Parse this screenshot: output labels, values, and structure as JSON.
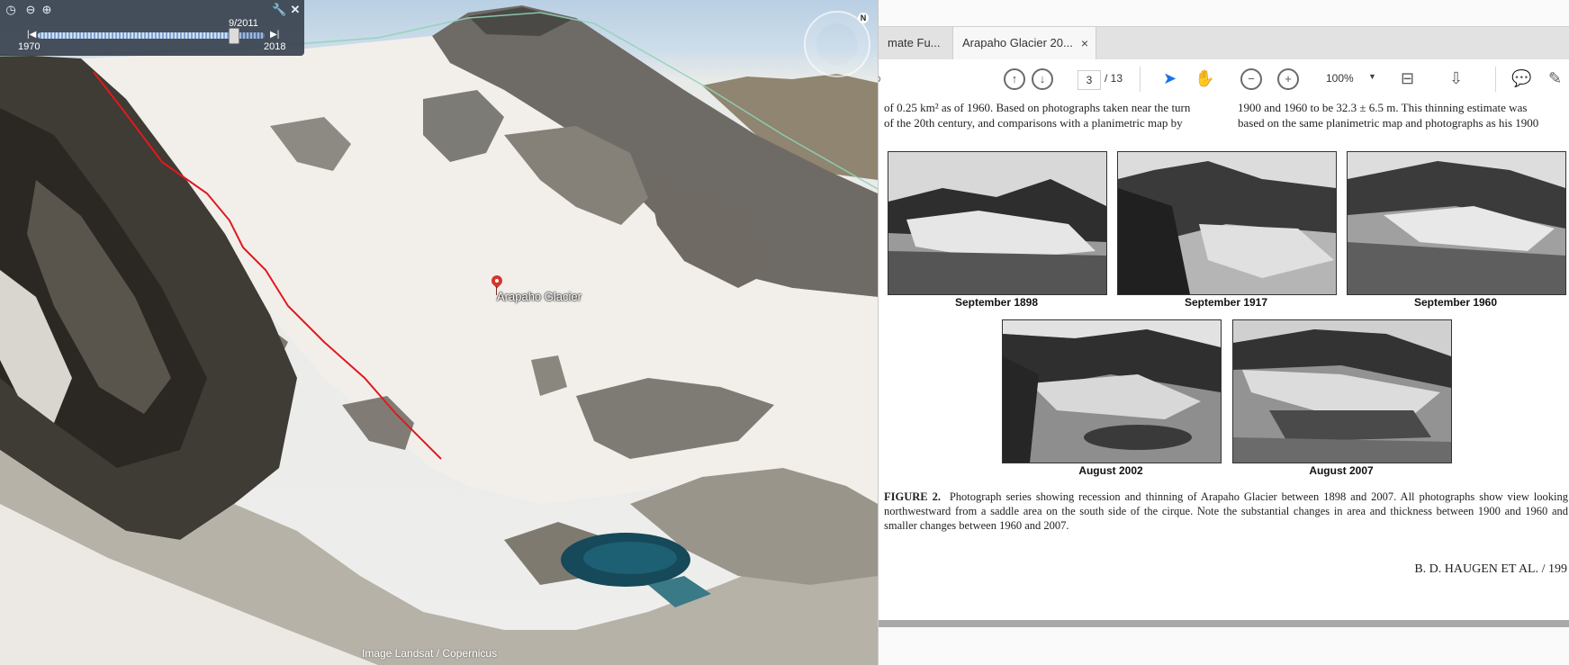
{
  "earth": {
    "placemark_label": "Arapaho Glacier",
    "attribution": "Image Landsat / Copernicus",
    "timeslider": {
      "current_date": "9/2011",
      "start_year": "1970",
      "end_year": "2018",
      "position_fraction": 0.86
    },
    "icons": [
      "clock-icon",
      "zoom-out-icon",
      "zoom-in-icon",
      "wrench-icon",
      "close-icon",
      "compass-icon"
    ]
  },
  "pdf": {
    "tabs": [
      {
        "label": "mate Fu..."
      },
      {
        "label": "Arapaho Glacier 20..."
      }
    ],
    "tab_close": "×",
    "toolbar": {
      "current_page": "3",
      "page_sep": "/ 13",
      "zoom": "100%"
    },
    "page": {
      "left_col": [
        "of 0.25 km² as of 1960. Based on photographs taken near the turn",
        "of the 20th century, and comparisons with a planimetric map by"
      ],
      "right_col": [
        "1900 and 1960 to be 32.3 ± 6.5 m. This thinning estimate was",
        "based on the same planimetric map and photographs as his 1900"
      ],
      "photos": [
        {
          "caption": "September 1898"
        },
        {
          "caption": "September 1917"
        },
        {
          "caption": "September 1960"
        },
        {
          "caption": "August 2002"
        },
        {
          "caption": "August 2007"
        }
      ],
      "figure_label": "FIGURE 2.",
      "figure_caption": "Photograph series showing recession and thinning of Arapaho Glacier between 1898 and 2007. All photographs show view looking northwestward from a saddle area on the south side of the cirque. Note the substantial changes in area and thickness between 1900 and 1960 and smaller changes between 1960 and 2007.",
      "footer": "B. D. HAUGEN ET AL. / 199"
    }
  }
}
